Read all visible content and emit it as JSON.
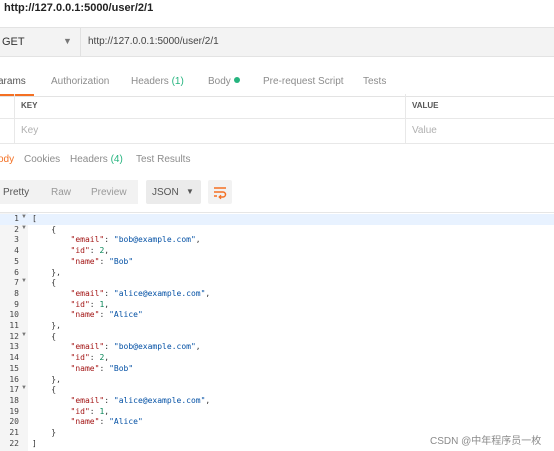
{
  "address_bar": {
    "url": "http://127.0.0.1:5000/user/2/1"
  },
  "request": {
    "method": "GET",
    "url": "http://127.0.0.1:5000/user/2/1"
  },
  "request_tabs": [
    {
      "label": "Params",
      "visible": "arams",
      "active": true
    },
    {
      "label": "Authorization"
    },
    {
      "label": "Headers",
      "count": "(1)"
    },
    {
      "label": "Body"
    },
    {
      "label": "Pre-request Script"
    },
    {
      "label": "Tests"
    }
  ],
  "params": {
    "headers": {
      "key": "KEY",
      "value": "VALUE"
    },
    "placeholders": {
      "key": "Key",
      "value": "Value"
    }
  },
  "response_tabs": [
    {
      "label": "Body",
      "visible": "ody",
      "active": true
    },
    {
      "label": "Cookies"
    },
    {
      "label": "Headers",
      "count": "(4)"
    },
    {
      "label": "Test Results"
    }
  ],
  "view_modes": [
    "Pretty",
    "Raw",
    "Preview"
  ],
  "format": "JSON",
  "code_lines": [
    {
      "n": "1",
      "fold": true,
      "parts": [
        {
          "t": "[",
          "c": "p"
        }
      ]
    },
    {
      "n": "2",
      "fold": true,
      "parts": [
        {
          "t": "    {",
          "c": "p"
        }
      ]
    },
    {
      "n": "3",
      "parts": [
        {
          "t": "        ",
          "c": "p"
        },
        {
          "t": "\"email\"",
          "c": "k"
        },
        {
          "t": ": ",
          "c": "p"
        },
        {
          "t": "\"bob@example.com\"",
          "c": "s"
        },
        {
          "t": ",",
          "c": "p"
        }
      ]
    },
    {
      "n": "4",
      "parts": [
        {
          "t": "        ",
          "c": "p"
        },
        {
          "t": "\"id\"",
          "c": "k"
        },
        {
          "t": ": ",
          "c": "p"
        },
        {
          "t": "2",
          "c": "n"
        },
        {
          "t": ",",
          "c": "p"
        }
      ]
    },
    {
      "n": "5",
      "parts": [
        {
          "t": "        ",
          "c": "p"
        },
        {
          "t": "\"name\"",
          "c": "k"
        },
        {
          "t": ": ",
          "c": "p"
        },
        {
          "t": "\"Bob\"",
          "c": "s"
        }
      ]
    },
    {
      "n": "6",
      "parts": [
        {
          "t": "    },",
          "c": "p"
        }
      ]
    },
    {
      "n": "7",
      "fold": true,
      "parts": [
        {
          "t": "    {",
          "c": "p"
        }
      ]
    },
    {
      "n": "8",
      "parts": [
        {
          "t": "        ",
          "c": "p"
        },
        {
          "t": "\"email\"",
          "c": "k"
        },
        {
          "t": ": ",
          "c": "p"
        },
        {
          "t": "\"alice@example.com\"",
          "c": "s"
        },
        {
          "t": ",",
          "c": "p"
        }
      ]
    },
    {
      "n": "9",
      "parts": [
        {
          "t": "        ",
          "c": "p"
        },
        {
          "t": "\"id\"",
          "c": "k"
        },
        {
          "t": ": ",
          "c": "p"
        },
        {
          "t": "1",
          "c": "n"
        },
        {
          "t": ",",
          "c": "p"
        }
      ]
    },
    {
      "n": "10",
      "parts": [
        {
          "t": "        ",
          "c": "p"
        },
        {
          "t": "\"name\"",
          "c": "k"
        },
        {
          "t": ": ",
          "c": "p"
        },
        {
          "t": "\"Alice\"",
          "c": "s"
        }
      ]
    },
    {
      "n": "11",
      "parts": [
        {
          "t": "    },",
          "c": "p"
        }
      ]
    },
    {
      "n": "12",
      "fold": true,
      "parts": [
        {
          "t": "    {",
          "c": "p"
        }
      ]
    },
    {
      "n": "13",
      "parts": [
        {
          "t": "        ",
          "c": "p"
        },
        {
          "t": "\"email\"",
          "c": "k"
        },
        {
          "t": ": ",
          "c": "p"
        },
        {
          "t": "\"bob@example.com\"",
          "c": "s"
        },
        {
          "t": ",",
          "c": "p"
        }
      ]
    },
    {
      "n": "14",
      "parts": [
        {
          "t": "        ",
          "c": "p"
        },
        {
          "t": "\"id\"",
          "c": "k"
        },
        {
          "t": ": ",
          "c": "p"
        },
        {
          "t": "2",
          "c": "n"
        },
        {
          "t": ",",
          "c": "p"
        }
      ]
    },
    {
      "n": "15",
      "parts": [
        {
          "t": "        ",
          "c": "p"
        },
        {
          "t": "\"name\"",
          "c": "k"
        },
        {
          "t": ": ",
          "c": "p"
        },
        {
          "t": "\"Bob\"",
          "c": "s"
        }
      ]
    },
    {
      "n": "16",
      "parts": [
        {
          "t": "    },",
          "c": "p"
        }
      ]
    },
    {
      "n": "17",
      "fold": true,
      "parts": [
        {
          "t": "    {",
          "c": "p"
        }
      ]
    },
    {
      "n": "18",
      "parts": [
        {
          "t": "        ",
          "c": "p"
        },
        {
          "t": "\"email\"",
          "c": "k"
        },
        {
          "t": ": ",
          "c": "p"
        },
        {
          "t": "\"alice@example.com\"",
          "c": "s"
        },
        {
          "t": ",",
          "c": "p"
        }
      ]
    },
    {
      "n": "19",
      "parts": [
        {
          "t": "        ",
          "c": "p"
        },
        {
          "t": "\"id\"",
          "c": "k"
        },
        {
          "t": ": ",
          "c": "p"
        },
        {
          "t": "1",
          "c": "n"
        },
        {
          "t": ",",
          "c": "p"
        }
      ]
    },
    {
      "n": "20",
      "parts": [
        {
          "t": "        ",
          "c": "p"
        },
        {
          "t": "\"name\"",
          "c": "k"
        },
        {
          "t": ": ",
          "c": "p"
        },
        {
          "t": "\"Alice\"",
          "c": "s"
        }
      ]
    },
    {
      "n": "21",
      "parts": [
        {
          "t": "    }",
          "c": "p"
        }
      ]
    },
    {
      "n": "22",
      "parts": [
        {
          "t": "]",
          "c": "p"
        }
      ]
    }
  ],
  "watermark": "CSDN @中年程序员一枚",
  "colors": {
    "accent": "#f47023",
    "status_green": "#26b47f",
    "json_key": "#a31515",
    "json_string": "#0451a5",
    "json_number": "#098658"
  }
}
